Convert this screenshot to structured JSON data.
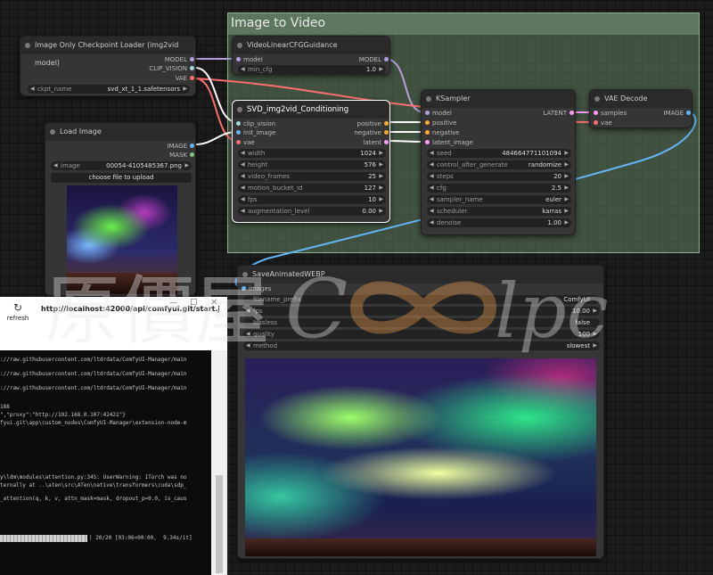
{
  "group": {
    "title": "Image to Video"
  },
  "ckpt_loader": {
    "title": "Image Only Checkpoint Loader (img2vid model)",
    "outputs": [
      "MODEL",
      "CLIP_VISION",
      "VAE"
    ],
    "widget_label": "ckpt_name",
    "widget_value": "svd_xt_1_1.safetensors"
  },
  "load_image": {
    "title": "Load Image",
    "outputs": [
      "IMAGE",
      "MASK"
    ],
    "widget_label": "image",
    "widget_value": "00054-4105485367.png",
    "upload_label": "choose file to upload"
  },
  "cfg_guidance": {
    "title": "VideoLinearCFGGuidance",
    "input": "model",
    "output": "MODEL",
    "widget_label": "min_cfg",
    "widget_value": "1.0"
  },
  "conditioning": {
    "title": "SVD_img2vid_Conditioning",
    "inputs": [
      "clip_vision",
      "init_image",
      "vae"
    ],
    "outputs": [
      "positive",
      "negative",
      "latent"
    ],
    "widgets": [
      {
        "label": "width",
        "value": "1024"
      },
      {
        "label": "height",
        "value": "576"
      },
      {
        "label": "video_frames",
        "value": "25"
      },
      {
        "label": "motion_bucket_id",
        "value": "127"
      },
      {
        "label": "fps",
        "value": "10"
      },
      {
        "label": "augmentation_level",
        "value": "0.00"
      }
    ]
  },
  "ksampler": {
    "title": "KSampler",
    "inputs": [
      "model",
      "positive",
      "negative",
      "latent_image"
    ],
    "output": "LATENT",
    "widgets": [
      {
        "label": "seed",
        "value": "484664771101094"
      },
      {
        "label": "control_after_generate",
        "value": "randomize"
      },
      {
        "label": "steps",
        "value": "20"
      },
      {
        "label": "cfg",
        "value": "2.5"
      },
      {
        "label": "sampler_name",
        "value": "euler"
      },
      {
        "label": "scheduler",
        "value": "karras"
      },
      {
        "label": "denoise",
        "value": "1.00"
      }
    ]
  },
  "vae_decode": {
    "title": "VAE Decode",
    "inputs": [
      "samples",
      "vae"
    ],
    "output": "IMAGE"
  },
  "save_webp": {
    "title": "SaveAnimatedWEBP",
    "input": "images",
    "widgets": [
      {
        "label": "filename_prefix",
        "value": "ComfyUI"
      },
      {
        "label": "fps",
        "value": "10.00"
      },
      {
        "label": "lossless",
        "value": "false"
      },
      {
        "label": "quality",
        "value": "100"
      },
      {
        "label": "method",
        "value": "slowest"
      }
    ]
  },
  "browser": {
    "refresh_label": "refresh",
    "url": "http://localhost:42000/api/comfyui.git/start.json"
  },
  "console": {
    "lines": [
      "://raw.githubusercontent.com/ltdrdata/ComfyUI-Manager/main",
      "://raw.githubusercontent.com/ltdrdata/ComfyUI-Manager/main",
      "://raw.githubusercontent.com/ltdrdata/ComfyUI-Manager/main",
      "188",
      "\",\"proxy\":\"http://192.168.0.107:42421\"}",
      "fyui.git\\app\\custom_nodes\\ComfyUI-Manager\\extension-node-m",
      "y\\ldm\\modules\\attention.py:345: UserWarning: 1Torch was no",
      "ternally at ..\\aten\\src\\ATen\\native\\transformers\\cuda\\sdp_",
      "_attention(q, k, v, attn_mask=mask, dropout_p=0.0, is_caus"
    ],
    "progress_text": "| 20/20 [03:06<00:00,  9.34s/it]",
    "progress_fraction": 1.0
  },
  "watermark": {
    "text": "原價屋 Coolpc"
  },
  "colors": {
    "link_model": "#b39ddb",
    "link_vae": "#ff6e6e",
    "link_image": "#64b5f6",
    "link_cond": "#ffa931",
    "link_clip_vision": "#a8dadc",
    "link_latent": "#ff9cf9"
  }
}
